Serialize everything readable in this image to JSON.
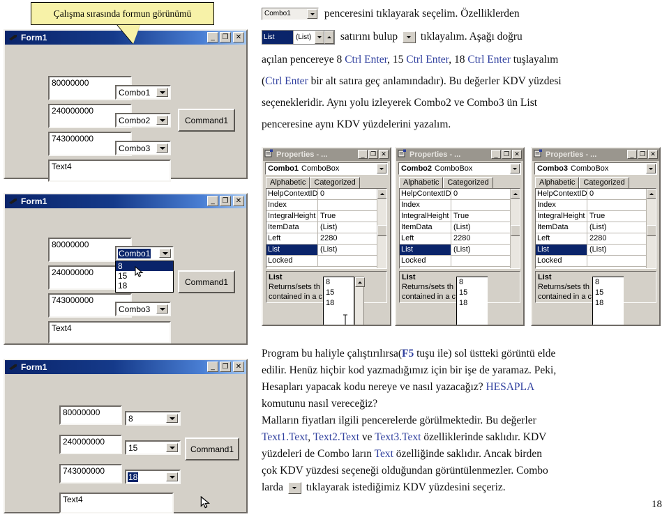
{
  "callout": {
    "text": "Çalışma sırasında  formun görünümü"
  },
  "forms": [
    {
      "title": "Form1",
      "textboxes": [
        "80000000",
        "240000000",
        "743000000",
        "Text4"
      ],
      "combos": [
        {
          "value": "Combo1",
          "selected": false,
          "open": false
        },
        {
          "value": "Combo2",
          "selected": false,
          "open": false
        },
        {
          "value": "Combo3",
          "selected": false,
          "open": false
        }
      ],
      "button": "Command1"
    },
    {
      "title": "Form1",
      "textboxes": [
        "80000000",
        "240000000",
        "743000000",
        "Text4"
      ],
      "combos": [
        {
          "value": "Combo1",
          "selected": true,
          "open": true,
          "items": [
            "8",
            "15",
            "18"
          ],
          "highlighted": "8"
        },
        {
          "value": "Combo3",
          "selected": false,
          "open": false
        }
      ],
      "button": "Command1"
    },
    {
      "title": "Form1",
      "textboxes": [
        "80000000",
        "240000000",
        "743000000",
        "Text4"
      ],
      "combos": [
        {
          "value": "8",
          "selected": false,
          "open": false
        },
        {
          "value": "15",
          "selected": false,
          "open": false
        },
        {
          "value": "18",
          "selected": true,
          "open": false
        }
      ],
      "button": "Command1"
    }
  ],
  "top_text": {
    "inline_combo_value": "Combo1",
    "inline_listrow": {
      "key": "List",
      "value": "(List)"
    },
    "line1_after": "penceresini tıklayarak seçelim. Özelliklerden",
    "line2_a": "satırını bulup",
    "line2_b": "tıklayalım. Aşağı doğru",
    "line3": {
      "a": "açılan pencereye 8 ",
      "k1": "Ctrl Enter",
      "b": ", 15 ",
      "k2": "Ctrl Enter",
      "c": ", 18 ",
      "k3": "Ctrl Enter",
      "d": " tuşlayalım"
    },
    "line4": {
      "a": "(",
      "k": "Ctrl Enter",
      "b": " bir alt satıra geç anlamındadır). Bu değerler KDV yüzdesi"
    },
    "line5": "seçenekleridir.  Aynı yolu izleyerek Combo2 ve Combo3 ün List",
    "line6": "penceresine aynı KDV yüzdelerini yazalım."
  },
  "properties": [
    {
      "window_title": "Properties - ...",
      "object_name": "Combo1",
      "object_type": "ComboBox",
      "tabs": [
        "Alphabetic",
        "Categorized"
      ],
      "rows": [
        {
          "k": "HelpContextID",
          "v": "0"
        },
        {
          "k": "Index",
          "v": ""
        },
        {
          "k": "IntegralHeight",
          "v": "True"
        },
        {
          "k": "ItemData",
          "v": "(List)"
        },
        {
          "k": "Left",
          "v": "2280"
        },
        {
          "k": "List",
          "v": "(List)",
          "selected": true
        },
        {
          "k": "Locked",
          "v": ""
        }
      ],
      "popup_items": [
        "8",
        "15",
        "18"
      ],
      "desc_title": "List",
      "desc_line1": "Returns/sets th",
      "desc_line2": "contained in a c"
    },
    {
      "window_title": "Properties - ...",
      "object_name": "Combo2",
      "object_type": "ComboBox",
      "tabs": [
        "Alphabetic",
        "Categorized"
      ],
      "rows": [
        {
          "k": "HelpContextID",
          "v": "0"
        },
        {
          "k": "Index",
          "v": ""
        },
        {
          "k": "IntegralHeight",
          "v": "True"
        },
        {
          "k": "ItemData",
          "v": "(List)"
        },
        {
          "k": "Left",
          "v": "2280"
        },
        {
          "k": "List",
          "v": "(List)",
          "selected": true
        },
        {
          "k": "Locked",
          "v": ""
        }
      ],
      "popup_items": [
        "8",
        "15",
        "18"
      ],
      "desc_title": "List",
      "desc_line1": "Returns/sets th",
      "desc_line2": "contained in a c"
    },
    {
      "window_title": "Properties - ...",
      "object_name": "Combo3",
      "object_type": "ComboBox",
      "tabs": [
        "Alphabetic",
        "Categorized"
      ],
      "rows": [
        {
          "k": "HelpContextID",
          "v": "0"
        },
        {
          "k": "Index",
          "v": ""
        },
        {
          "k": "IntegralHeight",
          "v": "True"
        },
        {
          "k": "ItemData",
          "v": "(List)"
        },
        {
          "k": "Left",
          "v": "2280"
        },
        {
          "k": "List",
          "v": "(List)",
          "selected": true
        },
        {
          "k": "Locked",
          "v": ""
        }
      ],
      "popup_items": [
        "8",
        "15",
        "18"
      ],
      "desc_title": "List",
      "desc_line1": "Returns/sets th",
      "desc_line2": "contained in a c"
    }
  ],
  "bottom_text": {
    "l1_a": "Program bu haliyle çalıştırılırsa(",
    "l1_k": "F5",
    "l1_b": " tuşu ile)  sol üstteki görüntü elde",
    "l2": "edilir. Henüz hiçbir kod yazmadığımız için bir işe de yaramaz. Peki,",
    "l3_a": "Hesapları yapacak kodu nereye ve nasıl yazacağız? ",
    "l3_k": "HESAPLA",
    "l4": "komutunu nasıl vereceğiz?",
    "l5": "Malların fiyatları ilgili pencerelerde görülmektedir. Bu değerler",
    "l6_k1": "Text1.Text",
    "l6_a": ", ",
    "l6_k2": "Text2.Text",
    "l6_b": " ve ",
    "l6_k3": "Text3.Text",
    "l6_c": " özelliklerinde saklıdır. KDV",
    "l7_a": "yüzdeleri de Combo ların ",
    "l7_k": "Text",
    "l7_b": " özelliğinde saklıdır. Ancak birden",
    "l8": "çok KDV yüzdesi seçeneği olduğundan görüntülenmezler.  Combo",
    "l9_a": "larda",
    "l9_b": "tıklayarak istediğimiz KDV yüzdesini seçeriz."
  },
  "page_number": "18",
  "colors": {
    "face": "#d4d0c8",
    "titlebar_start": "#0a246a",
    "titlebar_end": "#a6c8f0",
    "selection": "#0a246a",
    "callout_fill": "#f7f2a8",
    "link_blue": "#2f3f9e"
  }
}
